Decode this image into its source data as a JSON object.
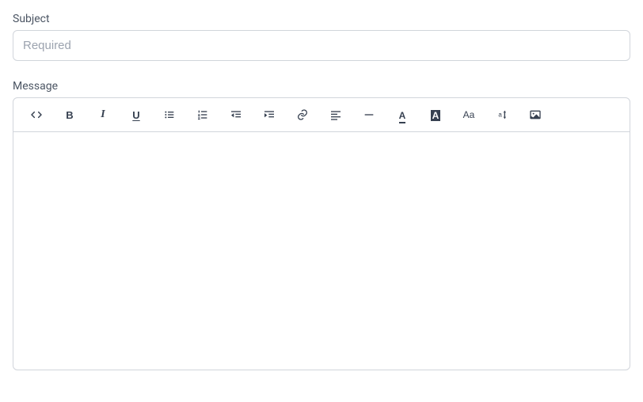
{
  "subject": {
    "label": "Subject",
    "placeholder": "Required",
    "value": ""
  },
  "message": {
    "label": "Message",
    "value": ""
  },
  "toolbar": {
    "code": "Code view",
    "bold": "Bold",
    "italic": "Italic",
    "underline": "Underline",
    "unordered_list": "Bulleted list",
    "ordered_list": "Numbered list",
    "indent_decrease": "Decrease indent",
    "indent_increase": "Increase indent",
    "link": "Insert link",
    "align": "Align",
    "horizontal_rule": "Horizontal rule",
    "font_color": "Font color",
    "background_color": "Background color",
    "font_size": "Font size",
    "line_height": "Line height",
    "image": "Insert image"
  }
}
